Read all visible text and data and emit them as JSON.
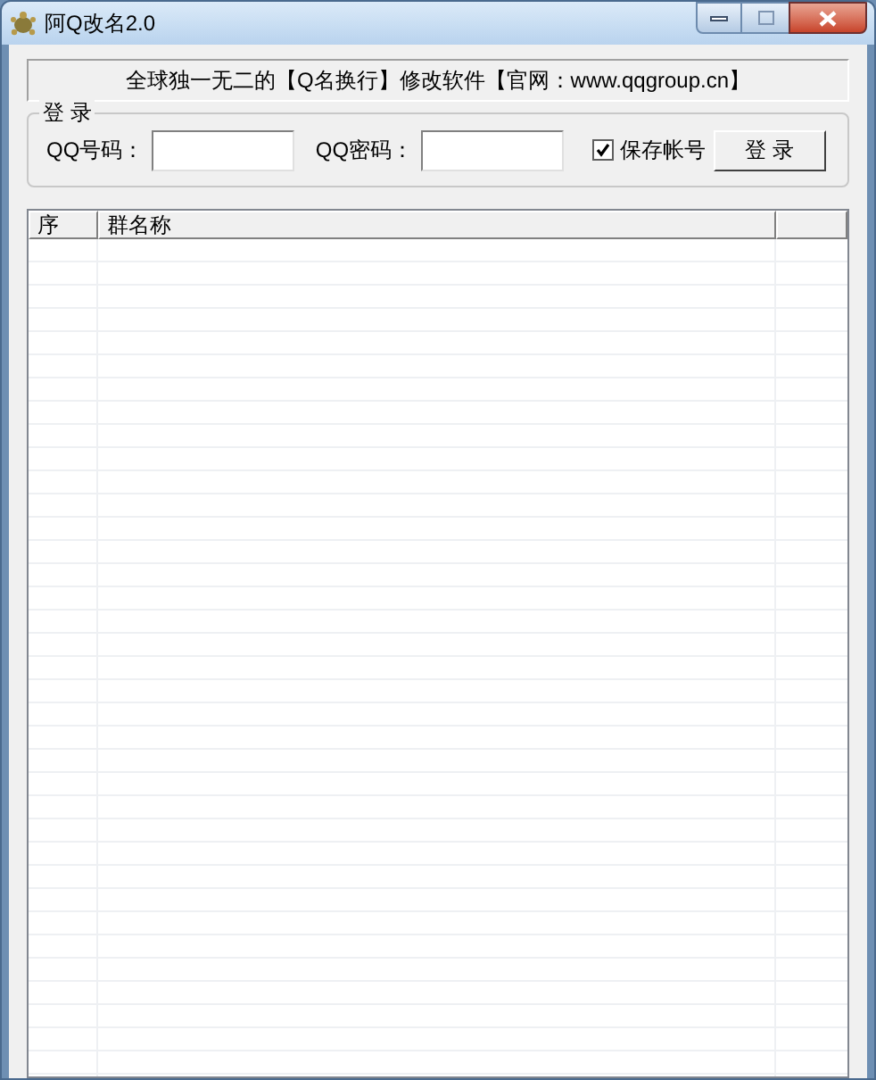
{
  "window": {
    "title": "阿Q改名2.0"
  },
  "banner": "全球独一无二的【Q名换行】修改软件【官网：www.qqgroup.cn】",
  "login": {
    "legend": "登 录",
    "qq_label": "QQ号码：",
    "password_label": "QQ密码：",
    "save_account": {
      "label": "保存帐号",
      "checked": true
    },
    "button": "登 录"
  },
  "table": {
    "columns": [
      "序",
      "群名称"
    ]
  }
}
